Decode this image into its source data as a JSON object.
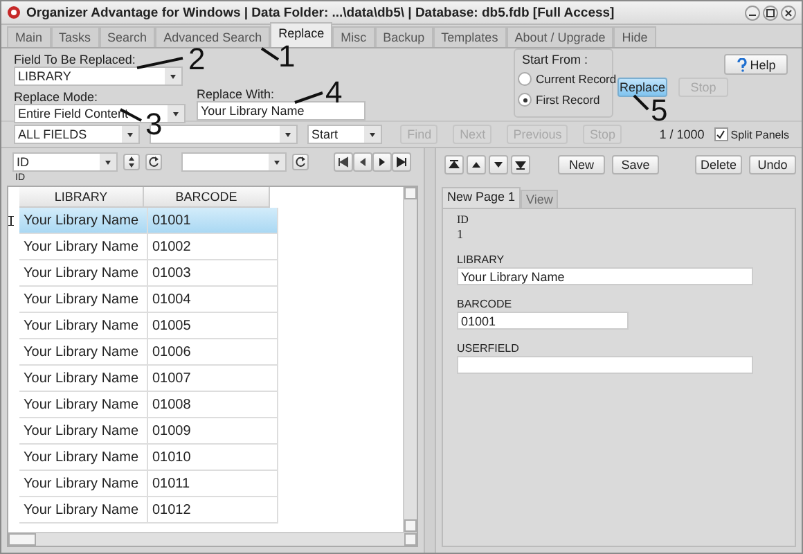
{
  "window": {
    "title": "Organizer Advantage for Windows | Data Folder: ...\\data\\db5\\ | Database: db5.fdb [Full Access]"
  },
  "tabs": [
    {
      "label": "Main",
      "selected": false
    },
    {
      "label": "Tasks",
      "selected": false
    },
    {
      "label": "Search",
      "selected": false
    },
    {
      "label": "Advanced Search",
      "selected": false
    },
    {
      "label": "Replace",
      "selected": true
    },
    {
      "label": "Misc",
      "selected": false
    },
    {
      "label": "Backup",
      "selected": false
    },
    {
      "label": "Templates",
      "selected": false
    },
    {
      "label": "About / Upgrade",
      "selected": false
    },
    {
      "label": "Hide",
      "selected": false
    }
  ],
  "replace_panel": {
    "field_label": "Field To Be Replaced:",
    "field_value": "LIBRARY",
    "mode_label": "Replace Mode:",
    "mode_value": "Entire Field Content",
    "with_label": "Replace With:",
    "with_value": "Your Library Name",
    "start_from": {
      "label": "Start From :",
      "options": [
        {
          "label": "Current Record",
          "selected": false
        },
        {
          "label": "First Record",
          "selected": true
        }
      ]
    },
    "buttons": [
      {
        "label": "Replace",
        "disabled": false
      },
      {
        "label": "Stop",
        "disabled": true
      }
    ],
    "help": "Help"
  },
  "annotations": [
    "1",
    "2",
    "3",
    "4",
    "5"
  ],
  "search_bar": {
    "field": "ALL FIELDS",
    "start": "Start",
    "buttons": [
      {
        "label": "Find",
        "disabled": true
      },
      {
        "label": "Next",
        "disabled": true
      },
      {
        "label": "Previous",
        "disabled": true
      },
      {
        "label": "Stop",
        "disabled": true
      }
    ],
    "record_count": "1 / 1000",
    "split_panels": {
      "label": "Split Panels",
      "checked": true
    }
  },
  "grid_toolbar": {
    "sort_field": "ID",
    "sort_caption": "ID"
  },
  "grid": {
    "columns": [
      "LIBRARY",
      "BARCODE"
    ],
    "rows": [
      {
        "library": "Your Library Name",
        "barcode": "01001",
        "selected": true
      },
      {
        "library": "Your Library Name",
        "barcode": "01002",
        "selected": false
      },
      {
        "library": "Your Library Name",
        "barcode": "01003",
        "selected": false
      },
      {
        "library": "Your Library Name",
        "barcode": "01004",
        "selected": false
      },
      {
        "library": "Your Library Name",
        "barcode": "01005",
        "selected": false
      },
      {
        "library": "Your Library Name",
        "barcode": "01006",
        "selected": false
      },
      {
        "library": "Your Library Name",
        "barcode": "01007",
        "selected": false
      },
      {
        "library": "Your Library Name",
        "barcode": "01008",
        "selected": false
      },
      {
        "library": "Your Library Name",
        "barcode": "01009",
        "selected": false
      },
      {
        "library": "Your Library Name",
        "barcode": "01010",
        "selected": false
      },
      {
        "library": "Your Library Name",
        "barcode": "01011",
        "selected": false
      },
      {
        "library": "Your Library Name",
        "barcode": "01012",
        "selected": false
      }
    ]
  },
  "record_toolbar": {
    "buttons": [
      "New",
      "Save",
      "Delete",
      "Undo"
    ]
  },
  "form_tabs": [
    {
      "label": "New Page 1",
      "selected": true
    },
    {
      "label": "View",
      "selected": false
    }
  ],
  "form": {
    "fields": [
      {
        "label": "ID",
        "value": "1",
        "kind": "readonly"
      },
      {
        "label": "LIBRARY",
        "value": "Your Library Name",
        "kind": "wide"
      },
      {
        "label": "BARCODE",
        "value": "01001",
        "kind": "short"
      },
      {
        "label": "USERFIELD",
        "kind": "wide"
      }
    ]
  }
}
